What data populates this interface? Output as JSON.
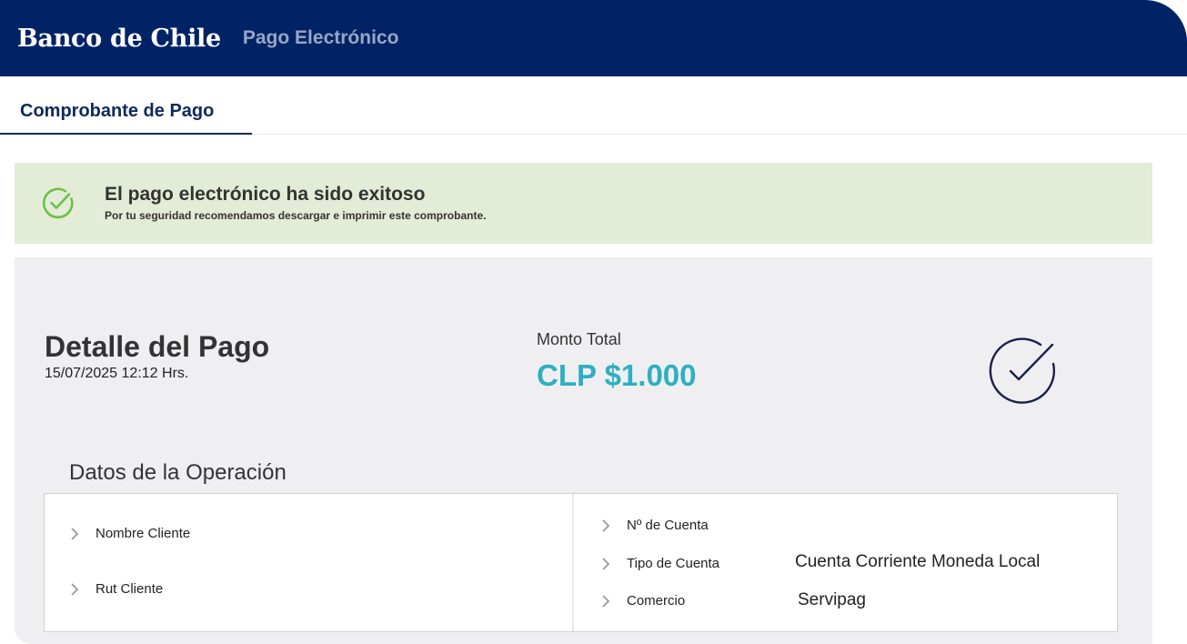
{
  "header": {
    "brand": "Banco de Chile",
    "subtitle": "Pago Electrónico"
  },
  "tabs": [
    {
      "label": "Comprobante de Pago",
      "active": true
    }
  ],
  "alert": {
    "title": "El pago electrónico ha sido exitoso",
    "message": "Por tu seguridad recomendamos descargar e imprimir este comprobante.",
    "icon": "check-circle-icon",
    "color": "#6cc04a"
  },
  "detail": {
    "title": "Detalle del Pago",
    "date": "15/07/2025 12:12 Hrs.",
    "amount_label": "Monto Total",
    "amount_value": "CLP $1.000",
    "amount_color": "#2eafc2"
  },
  "operation": {
    "title": "Datos de la Operación",
    "left_rows": [
      {
        "label": "Nombre Cliente",
        "value": ""
      },
      {
        "label": "Rut Cliente",
        "value": ""
      }
    ],
    "right_rows": [
      {
        "label": "Nº de Cuenta",
        "value": ""
      },
      {
        "label": "Tipo de Cuenta",
        "value": "Cuenta Corriente Moneda Local"
      },
      {
        "label": "Comercio",
        "value": "Servipag"
      }
    ]
  },
  "colors": {
    "header_bg": "#002366",
    "alert_bg": "#e3ecd6",
    "card_bg": "#efeff1"
  }
}
